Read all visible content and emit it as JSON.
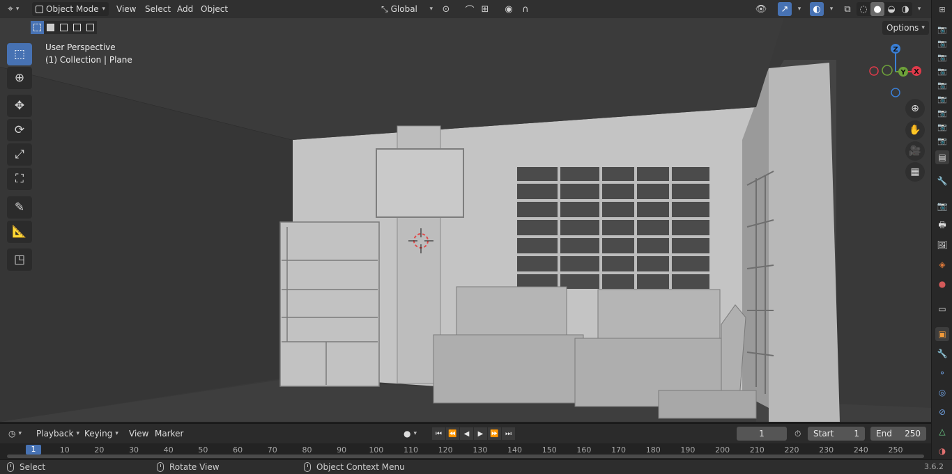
{
  "header": {
    "editor_type_icon": "axes-icon",
    "mode": "Object Mode",
    "menus": [
      "View",
      "Select",
      "Add",
      "Object"
    ],
    "orientation": "Global",
    "options_label": "Options"
  },
  "viewport": {
    "perspective_label": "User Perspective",
    "collection_label": "(1) Collection | Plane",
    "gizmo_axes": {
      "z": "Z",
      "y": "Y",
      "x": "X"
    },
    "axis_colors": {
      "x": "#e03a4a",
      "y": "#6ea23a",
      "z": "#3a7fd6"
    },
    "tools": [
      "select-box",
      "cursor",
      "move",
      "rotate",
      "scale",
      "transform",
      "annotate",
      "measure",
      "add-cube"
    ],
    "nav_buttons": [
      "zoom-icon",
      "pan-hand-icon",
      "camera-icon",
      "ortho-grid-icon"
    ]
  },
  "timeline": {
    "menus": [
      "Playback",
      "Keying",
      "View",
      "Marker"
    ],
    "current_frame": "1",
    "start_label": "Start",
    "start_value": "1",
    "end_label": "End",
    "end_value": "250",
    "ruler_marks": [
      "1",
      "10",
      "20",
      "30",
      "40",
      "50",
      "60",
      "70",
      "80",
      "90",
      "100",
      "110",
      "120",
      "130",
      "140",
      "150",
      "160",
      "170",
      "180",
      "190",
      "200",
      "210",
      "220",
      "230",
      "240",
      "250"
    ],
    "current_marker": "1"
  },
  "status": {
    "select": "Select",
    "rotate": "Rotate View",
    "context": "Object Context Menu",
    "version": "3.6.2"
  }
}
